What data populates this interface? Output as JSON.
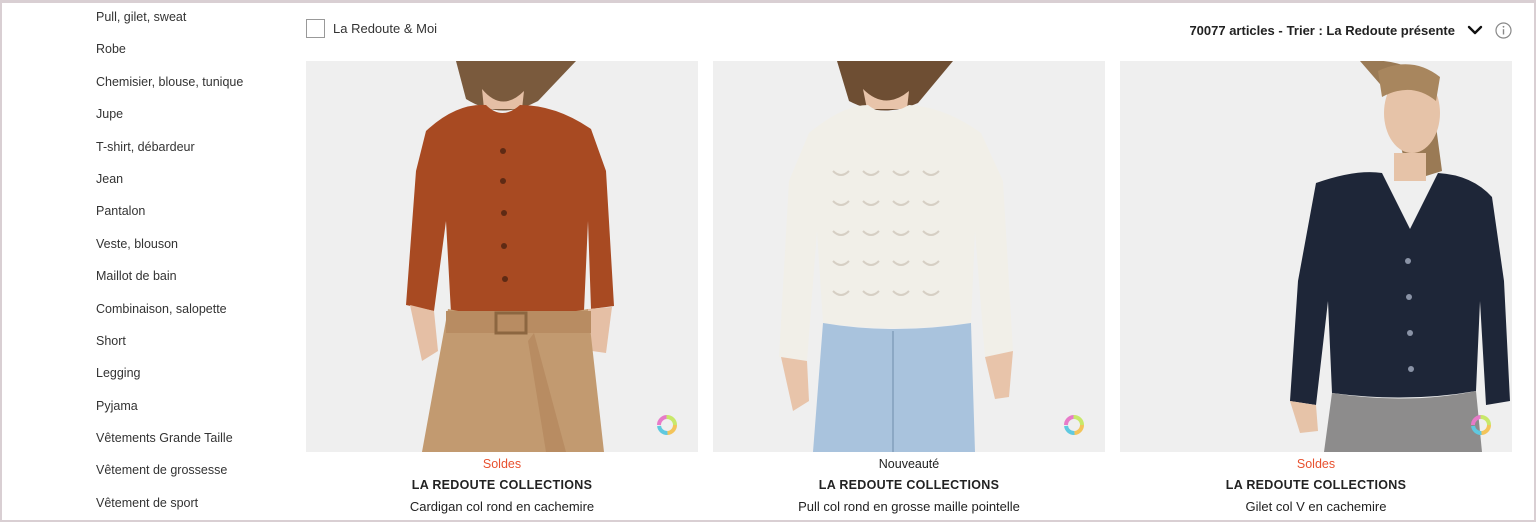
{
  "sidebar": {
    "items": [
      {
        "label": "Pull, gilet, sweat"
      },
      {
        "label": "Robe"
      },
      {
        "label": "Chemisier, blouse, tunique"
      },
      {
        "label": "Jupe"
      },
      {
        "label": "T-shirt, débardeur"
      },
      {
        "label": "Jean"
      },
      {
        "label": "Pantalon"
      },
      {
        "label": "Veste, blouson"
      },
      {
        "label": "Maillot de bain"
      },
      {
        "label": "Combinaison, salopette"
      },
      {
        "label": "Short"
      },
      {
        "label": "Legging"
      },
      {
        "label": "Pyjama"
      },
      {
        "label": "Vêtements Grande Taille"
      },
      {
        "label": "Vêtement de grossesse"
      },
      {
        "label": "Vêtement de sport"
      }
    ]
  },
  "toolbar": {
    "filter_label": "La Redoute & Moi",
    "article_count": "70077 articles -",
    "sort_label": "Trier : La Redoute présente"
  },
  "products": [
    {
      "badge": "Soldes",
      "brand": "LA REDOUTE COLLECTIONS",
      "name": "Cardigan col rond en cachemire",
      "garment_color": "#a84a22"
    },
    {
      "badge": "Nouveauté",
      "brand": "LA REDOUTE COLLECTIONS",
      "name": "Pull col rond en grosse maille pointelle",
      "garment_color": "#f1efe8"
    },
    {
      "badge": "Soldes",
      "brand": "LA REDOUTE COLLECTIONS",
      "name": "Gilet col V en cachemire",
      "garment_color": "#1e2638"
    }
  ],
  "colors": {
    "sale": "#e8512f",
    "frame": "#d9cfd3",
    "image_bg": "#efefef"
  },
  "icons": {
    "filter_checkbox": "checkbox-icon",
    "sort_toggle": "chevron-down-icon",
    "info": "info-icon",
    "color_swatch": "color-wheel-icon"
  }
}
